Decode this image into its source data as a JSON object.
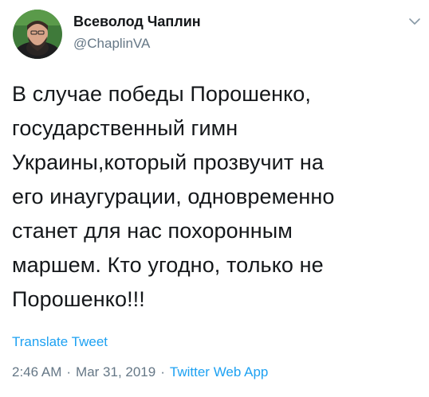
{
  "author": {
    "display_name": "Всеволод Чаплин",
    "handle": "@ChaplinVA"
  },
  "menu": {
    "icon": "chevron-down-icon"
  },
  "tweet": {
    "text_lines": [
      "В случае победы Порошенко,",
      "государственный гимн",
      "Украины,который прозвучит на",
      "его инаугурации, одновременно",
      "станет для нас похоронным",
      "маршем. Кто угодно, только не",
      "Порошенко!!!"
    ]
  },
  "translate_label": "Translate Tweet",
  "meta": {
    "time": "2:46 AM",
    "separator": "·",
    "date": "Mar 31, 2019",
    "source": "Twitter Web App"
  },
  "colors": {
    "text": "#14171a",
    "secondary": "#657786",
    "link": "#1da1f2"
  }
}
